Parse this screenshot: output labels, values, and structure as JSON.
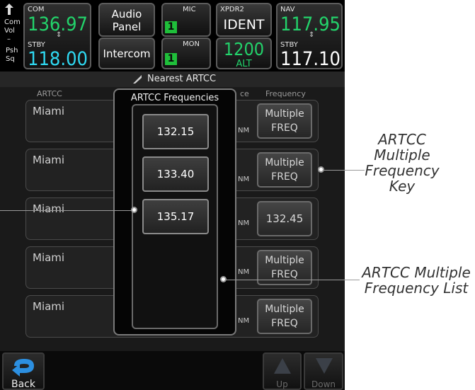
{
  "com": {
    "label": "COM",
    "active": "136.97",
    "standby_label": "STBY",
    "standby": "118.00",
    "side_label_top": "Com\nVol",
    "side_label_bottom": "Psh\nSq"
  },
  "audio": {
    "label_line1": "Audio",
    "label_line2": "Panel",
    "intercom": "Intercom"
  },
  "mic": {
    "label": "MIC",
    "value": "1",
    "mon_label": "MON",
    "mon_value": "1"
  },
  "xpdr": {
    "label": "XPDR2",
    "mode": "IDENT",
    "code": "1200",
    "alt": "ALT"
  },
  "nav": {
    "label": "NAV",
    "active": "117.95",
    "standby_label": "STBY",
    "standby": "117.10"
  },
  "page": {
    "title": "Nearest ARTCC"
  },
  "table": {
    "headers": {
      "artcc": "ARTCC",
      "distance_tail": "ce",
      "frequency": "Frequency"
    },
    "rows": [
      {
        "name": "Miami",
        "unit": "NM",
        "freq": "Multiple FREQ"
      },
      {
        "name": "Miami",
        "unit": "NM",
        "freq": "Multiple FREQ"
      },
      {
        "name": "Miami",
        "unit": "NM",
        "freq": "132.45"
      },
      {
        "name": "Miami",
        "unit": "NM",
        "freq": "Multiple FREQ"
      },
      {
        "name": "Miami",
        "unit": "NM",
        "freq": "Multiple FREQ"
      }
    ]
  },
  "popup": {
    "title": "ARTCC Frequencies",
    "items": [
      "132.15",
      "133.40",
      "135.17"
    ]
  },
  "softkeys": {
    "back": "Back",
    "up": "Up",
    "down": "Down"
  },
  "annotations": {
    "key": "ARTCC\nMultiple\nFrequency\nKey",
    "list": "ARTCC Multiple\nFrequency List"
  },
  "colors": {
    "com_active": "#23d36b",
    "nav_active": "#2fd9f2",
    "mic_box": "#1fbf3a"
  }
}
